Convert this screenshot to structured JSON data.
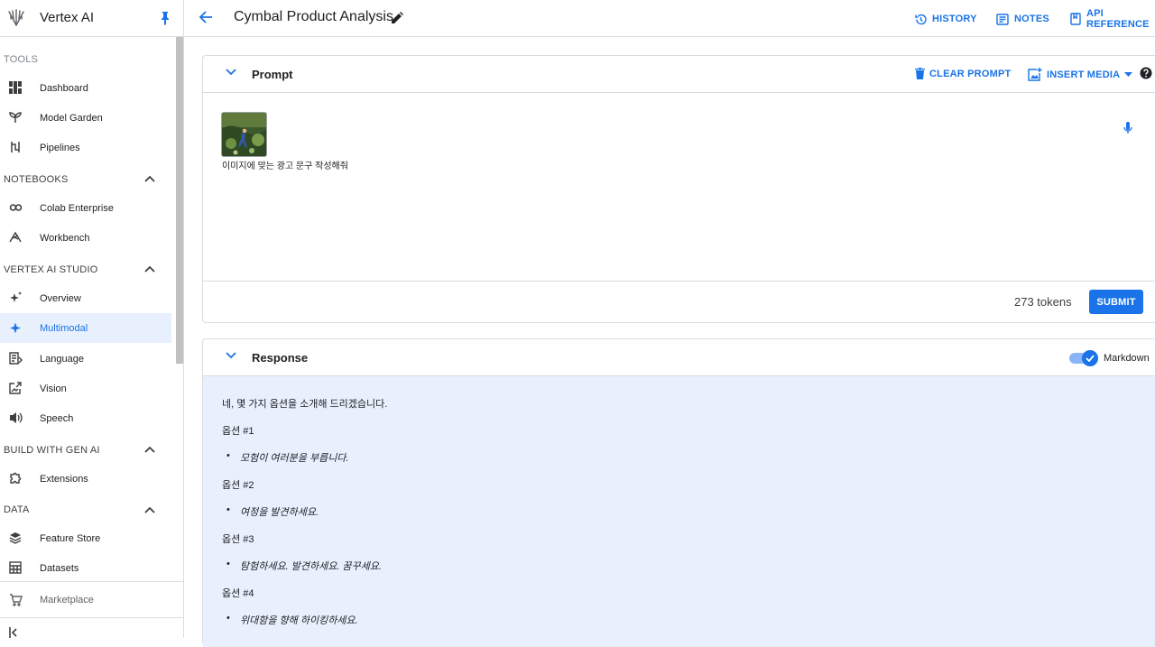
{
  "sidebar": {
    "brand": "Vertex AI",
    "sections": {
      "tools": "TOOLS",
      "notebooks": "NOTEBOOKS",
      "studio": "VERTEX AI STUDIO",
      "genai": "BUILD WITH GEN AI",
      "data": "DATA"
    },
    "items": {
      "dashboard": "Dashboard",
      "model_garden": "Model Garden",
      "pipelines": "Pipelines",
      "colab": "Colab Enterprise",
      "workbench": "Workbench",
      "overview": "Overview",
      "multimodal": "Multimodal",
      "language": "Language",
      "vision": "Vision",
      "speech": "Speech",
      "extensions": "Extensions",
      "feature_store": "Feature Store",
      "datasets": "Datasets"
    },
    "marketplace": "Marketplace"
  },
  "topbar": {
    "title": "Cymbal Product Analysis.",
    "history": "HISTORY",
    "notes": "NOTES",
    "api_reference": "API REFERENCE"
  },
  "prompt": {
    "title": "Prompt",
    "clear": "CLEAR PROMPT",
    "insert_media": "INSERT MEDIA",
    "text": "이미지에 맞는 광고 문구 작성해줘",
    "tokens": "273 tokens",
    "submit": "SUBMIT"
  },
  "response": {
    "title": "Response",
    "markdown_label": "Markdown",
    "markdown_enabled": true,
    "intro": "네, 몇 가지 옵션을 소개해 드리겠습니다.",
    "options": [
      {
        "heading": "옵션 #1",
        "text": "모험이 여러분을 부릅니다."
      },
      {
        "heading": "옵션 #2",
        "text": "여정을 발견하세요."
      },
      {
        "heading": "옵션 #3",
        "text": "탐험하세요. 발견하세요. 꿈꾸세요."
      },
      {
        "heading": "옵션 #4",
        "text": "위대함을 향해 하이킹하세요."
      }
    ]
  },
  "colors": {
    "accent": "#1a73e8",
    "response_bg": "#e8f0fe",
    "active_nav_bg": "#e8f0fe",
    "border": "#dadce0"
  }
}
